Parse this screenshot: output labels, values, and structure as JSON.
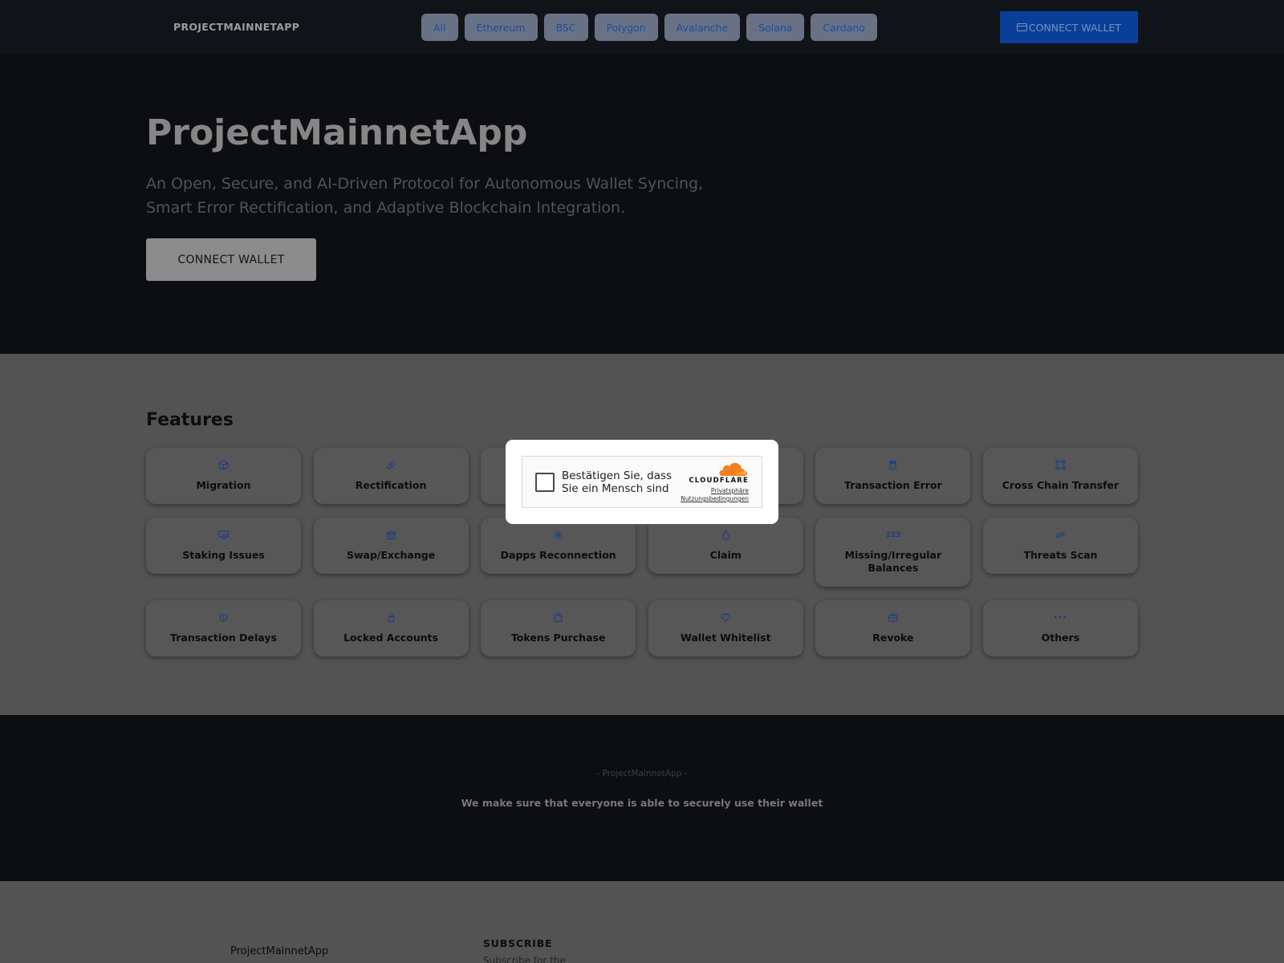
{
  "navbar": {
    "logo": "PROJECTMAINNETAPP",
    "tabs": [
      "All",
      "Ethereum",
      "BSC",
      "Polygon",
      "Avalanche",
      "Solana",
      "Cardano"
    ],
    "connect_label": "CONNECT WALLET",
    "connect_icon": "wallet-icon"
  },
  "hero": {
    "title": "ProjectMainnetApp",
    "subtitle": "An Open, Secure, and AI-Driven Protocol for Autonomous Wallet Syncing, Smart Error Rectification, and Adaptive Blockchain Integration.",
    "connect_label": "CONNECT WALLET"
  },
  "features": {
    "title": "Features",
    "items": [
      {
        "label": "Migration",
        "icon": "cube-icon"
      },
      {
        "label": "Rectification",
        "icon": "eraser-icon"
      },
      {
        "label": "",
        "icon": ""
      },
      {
        "label": "",
        "icon": ""
      },
      {
        "label": "Transaction Error",
        "icon": "calculator-icon"
      },
      {
        "label": "Cross Chain Transfer",
        "icon": "transfer-icon"
      },
      {
        "label": "Staking Issues",
        "icon": "coins-icon"
      },
      {
        "label": "Swap/Exchange",
        "icon": "bank-icon"
      },
      {
        "label": "Dapps Reconnection",
        "icon": "gear-icon"
      },
      {
        "label": "Claim",
        "icon": "drop-icon"
      },
      {
        "label": "Missing/Irregular Balances",
        "icon": "number-icon"
      },
      {
        "label": "Threats Scan",
        "icon": "link-icon"
      },
      {
        "label": "Transaction Delays",
        "icon": "alarm-icon"
      },
      {
        "label": "Locked Accounts",
        "icon": "lock-icon"
      },
      {
        "label": "Tokens Purchase",
        "icon": "bag-icon"
      },
      {
        "label": "Wallet Whitelist",
        "icon": "heart-icon"
      },
      {
        "label": "Revoke",
        "icon": "briefcase-icon"
      },
      {
        "label": "Others",
        "icon": "ellipsis-icon"
      }
    ]
  },
  "mission": {
    "tag": "- ProjectMainnetApp -",
    "text": "We make sure that everyone is able to securely use their wallet"
  },
  "footer": {
    "brand": "ProjectMainnetApp",
    "subscribe_heading": "SUBSCRIBE",
    "subscribe_text": "Subscribe for the"
  },
  "captcha": {
    "prompt": "Bestätigen Sie, dass Sie ein Mensch sind",
    "brand": "CLOUDFLARE",
    "link_privacy": "Privatsphäre",
    "link_terms": "Nutzungsbedingungen",
    "brand_color": "#f38020"
  },
  "colors": {
    "accent_blue": "#0a3f99",
    "icon_blue": "#1c3e86",
    "dark_bg": "#0c0e12",
    "gray_section": "#535353"
  }
}
